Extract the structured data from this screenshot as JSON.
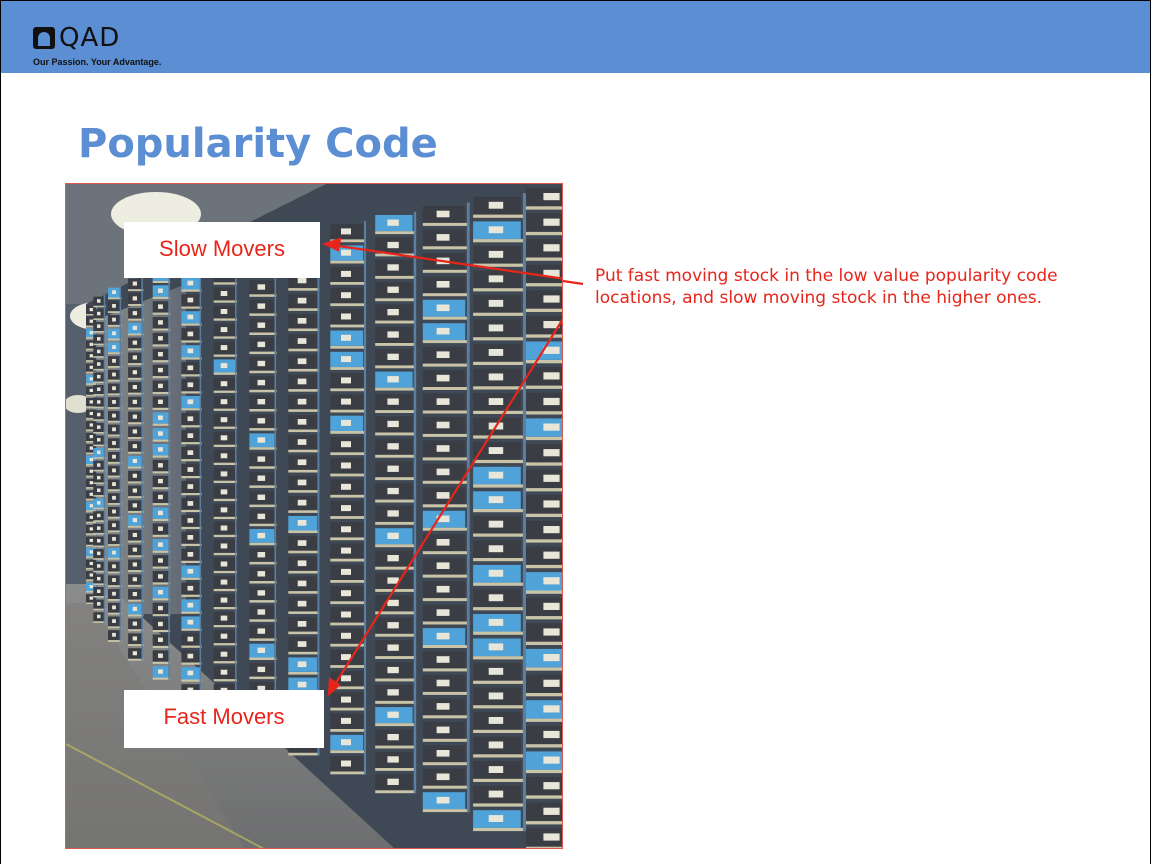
{
  "header": {
    "brand": "QAD",
    "tagline": "Our Passion. Your Advantage.",
    "logo_icon": "qad-logo-icon",
    "bar_color": "#5b8ed2"
  },
  "slide": {
    "title": "Popularity Code",
    "title_color": "#5b8ed2",
    "accent_color": "#e8251a"
  },
  "photo": {
    "subject": "warehouse shelving racks with blue and gray storage bins",
    "labels": {
      "slow": "Slow Movers",
      "fast": "Fast Movers"
    }
  },
  "annotation": {
    "text": "Put fast moving stock in the low value popularity code locations, and slow moving stock in the higher ones."
  }
}
